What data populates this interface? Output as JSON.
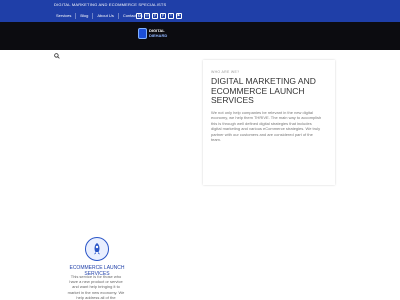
{
  "topbar": {
    "tagline": "DIGITAL MARKETING AND ECOMMERCE SPECIALISTS",
    "nav": [
      "Services",
      "Blog",
      "About Us",
      "Contact Us"
    ],
    "social_icons": [
      "facebook-icon",
      "instagram-icon",
      "pinterest-icon",
      "pinterest-icon",
      "twitter-icon",
      "youtube-icon"
    ],
    "color": "#1f3fa8"
  },
  "logo": {
    "line1": "DIGITAL",
    "line2": "DIEHARD"
  },
  "about": {
    "eyebrow": "WHO ARE WE?",
    "title": "DIGITAL MARKETING AND ECOMMERCE LAUNCH SERVICES",
    "body": "We not only help companies be relevant in the new digital economy, we help them THRIVE. The main way to accomplish this is through well defined digital strategies that includes digital marketing and various eCommerce strategies. We truly partner with our customers and are considered part of the team."
  },
  "service": {
    "title": "ECOMMERCE LAUNCH SERVICES",
    "desc": "This service is for those who have a new product or service and want help bringing it to market in the new economy. We help address all of the"
  }
}
